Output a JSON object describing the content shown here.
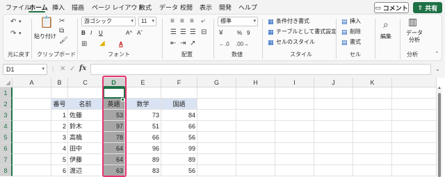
{
  "menu": {
    "items": [
      "ファイル",
      "ホーム",
      "挿入",
      "描画",
      "ページ レイアウト",
      "数式",
      "データ",
      "校閲",
      "表示",
      "開発",
      "ヘルプ"
    ],
    "active_index": 1,
    "comment_label": "コメント",
    "share_label": "共有"
  },
  "ribbon": {
    "undo": {
      "label": "元に戻す"
    },
    "clipboard": {
      "label": "クリップボード",
      "paste_label": "貼り付け"
    },
    "font": {
      "label": "フォント",
      "name": "游ゴシック",
      "size": "11",
      "bold": "B",
      "italic": "I",
      "underline": "U",
      "grow": "A^",
      "shrink": "Aˇ",
      "color_letter": "A"
    },
    "alignment": {
      "label": "配置"
    },
    "number": {
      "label": "数値",
      "format": "標準",
      "percent": "%",
      "comma": "9"
    },
    "styles": {
      "label": "スタイル",
      "conditional": "条件付き書式",
      "as_table": "テーブルとして書式設定",
      "cell_styles": "セルのスタイル"
    },
    "cells": {
      "label": "セル",
      "insert": "挿入",
      "delete": "削除",
      "format": "書式"
    },
    "editing": {
      "label": "編集"
    },
    "analysis": {
      "label": "分析",
      "button": "データ分析"
    }
  },
  "formula_bar": {
    "name_box": "D1",
    "fx": "fx",
    "formula": ""
  },
  "sheet": {
    "columns": [
      "A",
      "B",
      "C",
      "D",
      "E",
      "F",
      "G",
      "H",
      "I",
      "J",
      "K"
    ],
    "selected_column": "D",
    "rows": [
      "1",
      "2",
      "3",
      "4",
      "5",
      "6",
      "7",
      "8"
    ],
    "headers": {
      "no": "番号",
      "name": "名前",
      "english": "英語",
      "math": "数学",
      "japanese": "国語"
    },
    "records": [
      {
        "no": "1",
        "name": "佐藤",
        "english": "53",
        "math": "73",
        "japanese": "84"
      },
      {
        "no": "2",
        "name": "鈴木",
        "english": "97",
        "math": "51",
        "japanese": "66"
      },
      {
        "no": "3",
        "name": "高橋",
        "english": "78",
        "math": "66",
        "japanese": "56"
      },
      {
        "no": "4",
        "name": "田中",
        "english": "64",
        "math": "96",
        "japanese": "99"
      },
      {
        "no": "5",
        "name": "伊藤",
        "english": "64",
        "math": "89",
        "japanese": "89"
      },
      {
        "no": "6",
        "name": "渡辺",
        "english": "63",
        "math": "83",
        "japanese": "56"
      }
    ]
  },
  "colors": {
    "accent": "#1e7145",
    "highlight": "#e8336d",
    "header_fill": "#dae3f3",
    "selection_fill": "#a6a6a6"
  }
}
